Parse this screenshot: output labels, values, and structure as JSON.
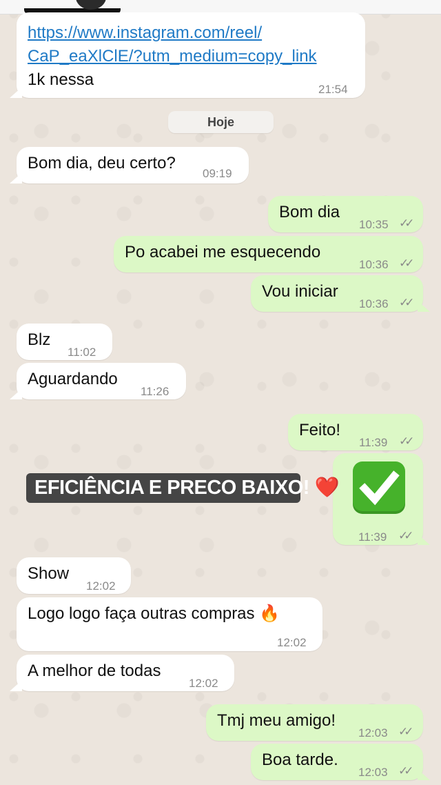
{
  "date_divider": "Hoje",
  "messages": [
    {
      "text_lines": [
        "https://www.instagram.com/reel/",
        "CaP_eaXlClE/?utm_medium=copy_link",
        "1k nessa"
      ],
      "time": "21:54"
    },
    {
      "text": "Bom dia, deu certo?",
      "time": "09:19"
    },
    {
      "text": "Bom dia",
      "time": "10:35"
    },
    {
      "text": "Po acabei me esquecendo",
      "time": "10:36"
    },
    {
      "text": "Vou iniciar",
      "time": "10:36"
    },
    {
      "text": "Blz",
      "time": "11:02"
    },
    {
      "text": "Aguardando",
      "time": "11:26"
    },
    {
      "text": "Feito!",
      "time": "11:39"
    },
    {
      "text": "✅",
      "time": "11:39"
    },
    {
      "text": "Show",
      "time": "12:02"
    },
    {
      "text": "Logo logo faça outras compras 🔥",
      "time": "12:02"
    },
    {
      "text": "A melhor de todas",
      "time": "12:02"
    },
    {
      "text": "Tmj meu amigo!",
      "time": "12:03"
    },
    {
      "text": "Boa tarde.",
      "time": "12:03"
    }
  ],
  "overlay_caption": "EFICIÊNCIA E PRECO BAIXO! ❤️",
  "read_ticks": "✓✓",
  "colors": {
    "incoming": "#ffffff",
    "outgoing": "#dcf8c6",
    "background": "#ece5dd",
    "link": "#1f7ac6"
  }
}
